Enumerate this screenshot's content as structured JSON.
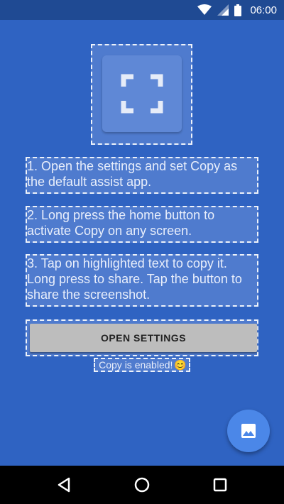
{
  "status_bar": {
    "time": "06:00",
    "icons": [
      "wifi-icon",
      "cellular-signal-icon",
      "battery-icon"
    ]
  },
  "main": {
    "app_icon": "fullscreen-corners-icon",
    "steps": [
      "1. Open the settings and set Copy as the default assist app.",
      "2. Long press the home button to activate Copy on any screen.",
      "3. Tap on highlighted text to copy it. Long press to share. Tap the button to share the screenshot."
    ],
    "open_settings_label": "OPEN SETTINGS",
    "status_text": "Copy is enabled!",
    "status_emoji": "😊"
  },
  "fab": {
    "icon": "image-icon"
  },
  "nav_bar": {
    "icons": [
      "back-icon",
      "home-icon",
      "recents-icon"
    ]
  },
  "colors": {
    "background": "#2f63c2",
    "status_bar": "#1f4a93",
    "fab": "#4b87e8",
    "button": "#bdbdbd"
  }
}
